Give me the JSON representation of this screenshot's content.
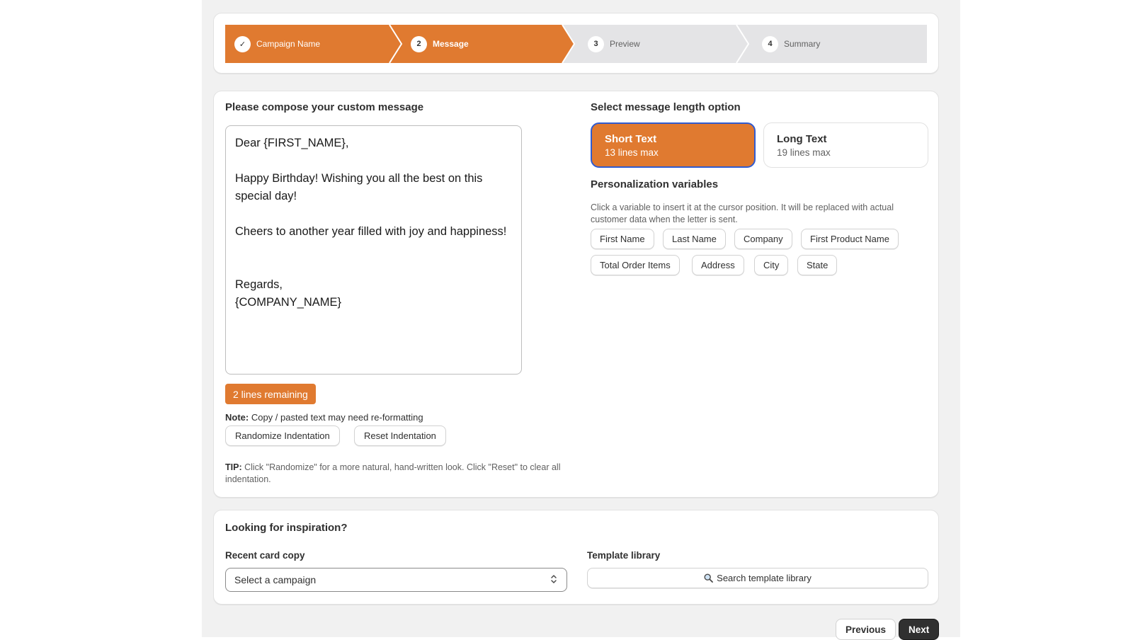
{
  "stepper": {
    "steps": [
      {
        "num": "✓",
        "label": "Campaign Name",
        "state": "complete"
      },
      {
        "num": "2",
        "label": "Message",
        "state": "current"
      },
      {
        "num": "3",
        "label": "Preview",
        "state": "upcoming"
      },
      {
        "num": "4",
        "label": "Summary",
        "state": "upcoming"
      }
    ],
    "colors": {
      "active": "#e07a30",
      "inactive": "#e4e4e6"
    }
  },
  "compose": {
    "heading": "Please compose your custom message",
    "message": "Dear {FIRST_NAME},\n\nHappy Birthday! Wishing you all the best on this special day!\n\nCheers to another year filled with joy and happiness!\n\n\nRegards,\n{COMPANY_NAME}",
    "lines_remaining": "2 lines remaining",
    "note_label": "Note:",
    "note_text": " Copy / pasted text may need re-formatting",
    "randomize_button": "Randomize Indentation",
    "reset_button": "Reset Indentation",
    "tip_label": "TIP:",
    "tip_text": " Click \"Randomize\" for a more natural, hand-written look. Click \"Reset\" to clear all indentation."
  },
  "length": {
    "heading": "Select message length option",
    "options": [
      {
        "title": "Short Text",
        "subtitle": "13 lines max",
        "selected": true
      },
      {
        "title": "Long Text",
        "subtitle": "19 lines max",
        "selected": false
      }
    ]
  },
  "variables": {
    "heading": "Personalization variables",
    "description": "Click a variable to insert it at the cursor position. It will be replaced with actual customer data when the letter is sent.",
    "chips": [
      "First Name",
      "Last Name",
      "Company",
      "First Product Name",
      "Total Order Items",
      "Address",
      "City",
      "State"
    ]
  },
  "inspiration": {
    "heading": "Looking for inspiration?",
    "recent_label": "Recent card copy",
    "recent_select_value": "Select a campaign",
    "template_label": "Template library",
    "search_label": "Search template library"
  },
  "footer": {
    "previous": "Previous",
    "next": "Next"
  }
}
